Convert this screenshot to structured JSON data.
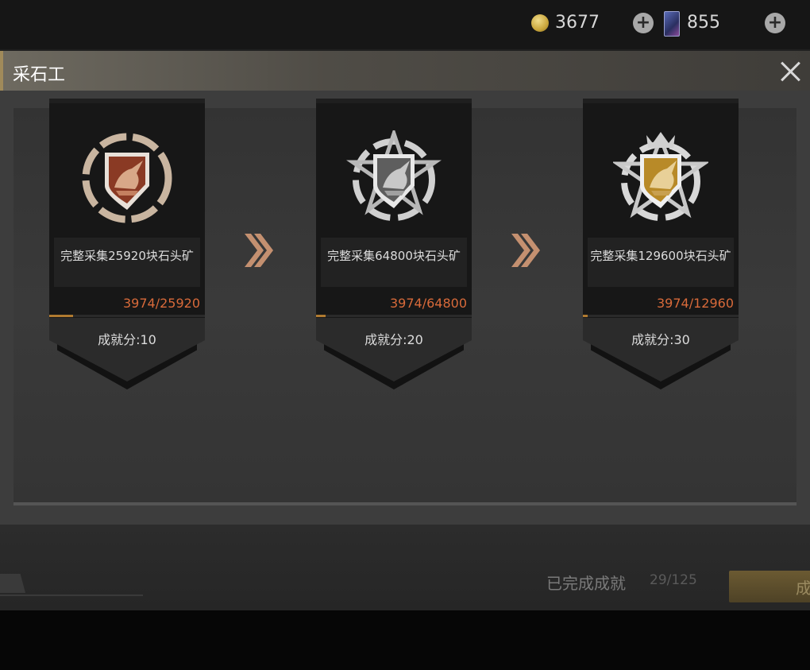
{
  "topbar": {
    "coin_value": "3677",
    "card_value": "855",
    "plus_symbol": "+",
    "icons": [
      "coin-icon",
      "plus-icon",
      "card-icon",
      "plus-icon"
    ]
  },
  "dialog": {
    "title": "采石工",
    "close_icon": "close-icon"
  },
  "achievements": [
    {
      "tier": "bronze",
      "desc": "完整采集25920块石头矿",
      "progress": "3974/25920",
      "progress_fraction": 0.153,
      "score": "成就分:10",
      "shield_color": "#8a3a24",
      "rim_color": "#c9b5a0"
    },
    {
      "tier": "silver",
      "desc": "完整采集64800块石头矿",
      "progress": "3974/64800",
      "progress_fraction": 0.061,
      "score": "成就分:20",
      "shield_color": "#5e5e5e",
      "rim_color": "#d0d0d0"
    },
    {
      "tier": "gold",
      "desc": "完整采集129600块石头矿",
      "progress": "3974/12960",
      "progress_fraction": 0.031,
      "score": "成就分:30",
      "shield_color": "#b88a28",
      "rim_color": "#d8d8d8"
    }
  ],
  "footer": {
    "completed_label": "已完成成就",
    "completed_count": "29/125",
    "button_label": "成"
  },
  "colors": {
    "progress_text": "#d86a3a",
    "arrow": "#c49070"
  }
}
